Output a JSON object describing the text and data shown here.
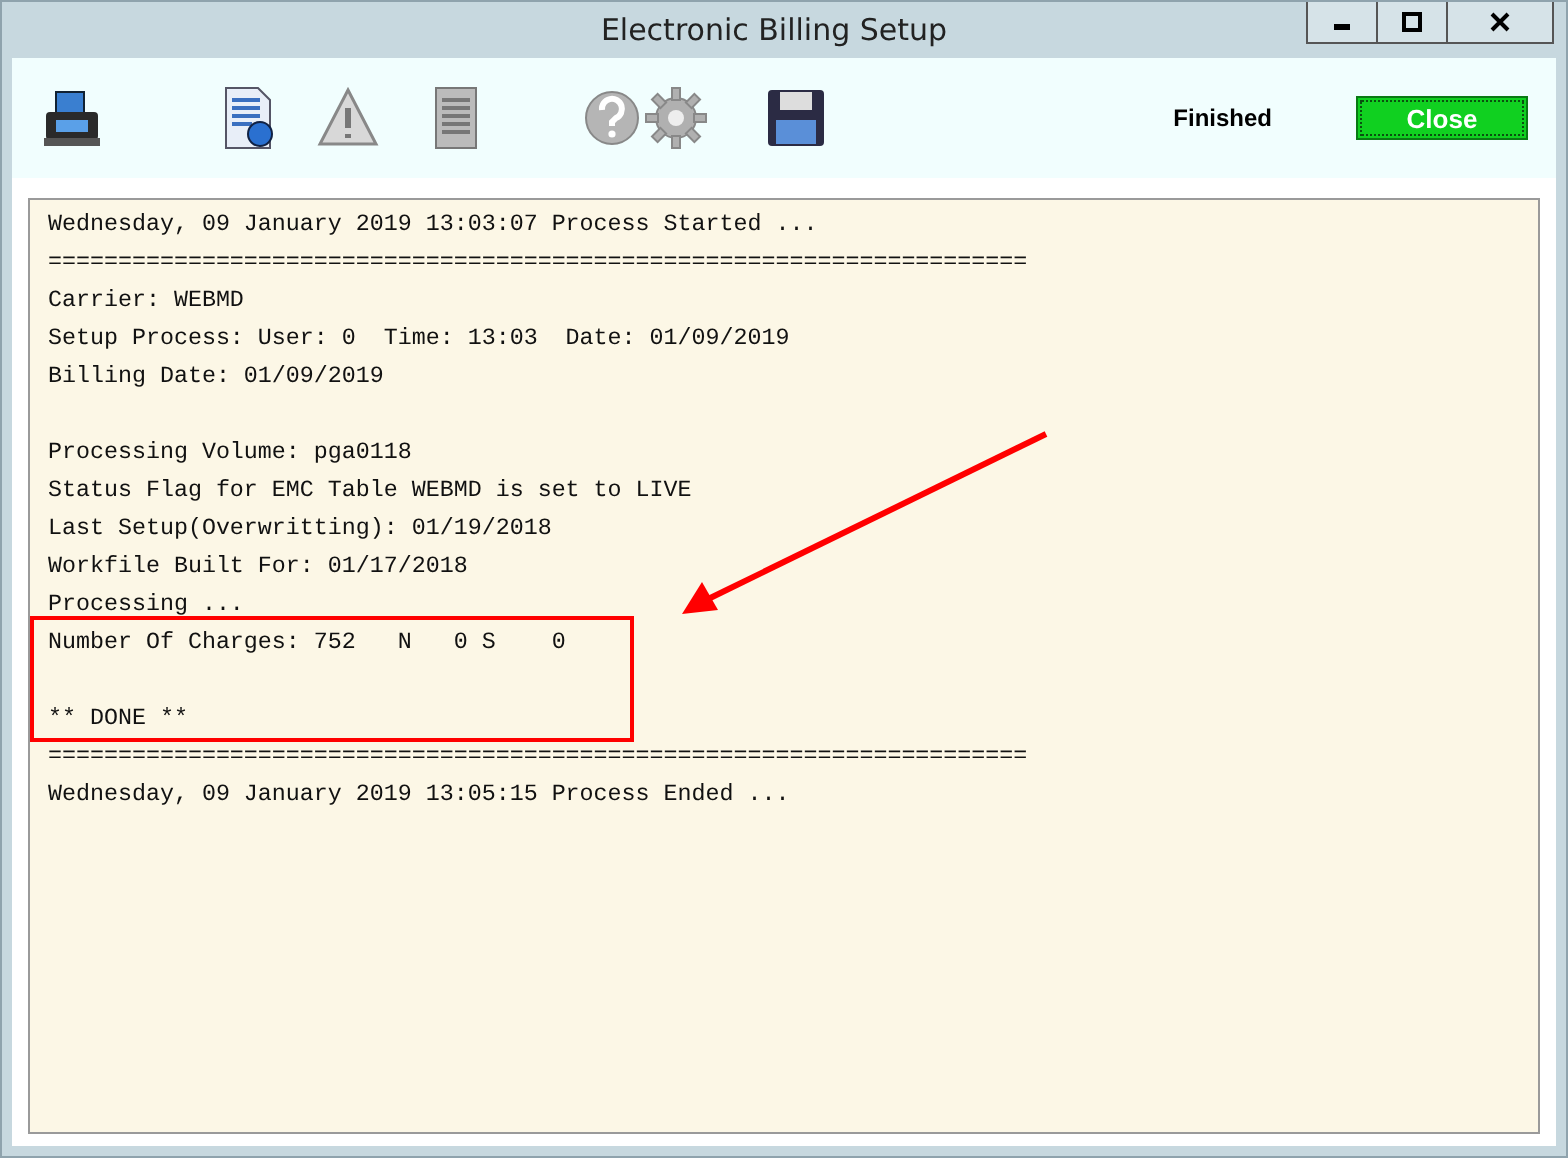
{
  "window": {
    "title": "Electronic Billing Setup"
  },
  "toolbar": {
    "icons": [
      {
        "kind": "fax"
      },
      {
        "kind": "report"
      },
      {
        "kind": "warning"
      },
      {
        "kind": "list"
      },
      {
        "kind": "help"
      },
      {
        "kind": "gear"
      },
      {
        "kind": "save"
      }
    ],
    "status": "Finished",
    "close_button": "Close"
  },
  "log": {
    "blocks": [
      [
        "Wednesday, 09 January 2019 13:03:07 Process Started ...",
        "======================================================================",
        "Carrier: WEBMD",
        "Setup Process: User: 0  Time: 13:03  Date: 01/09/2019",
        "Billing Date: 01/09/2019"
      ],
      [
        "Processing Volume: pga0118",
        "Status Flag for EMC Table WEBMD is set to LIVE",
        "Last Setup(Overwritting): 01/19/2018",
        "Workfile Built For: 01/17/2018",
        "Processing ...",
        "Number Of Charges: 752   N   0 S    0"
      ],
      [
        "** DONE **",
        "======================================================================",
        "Wednesday, 09 January 2019 13:05:15 Process Ended ..."
      ]
    ]
  }
}
